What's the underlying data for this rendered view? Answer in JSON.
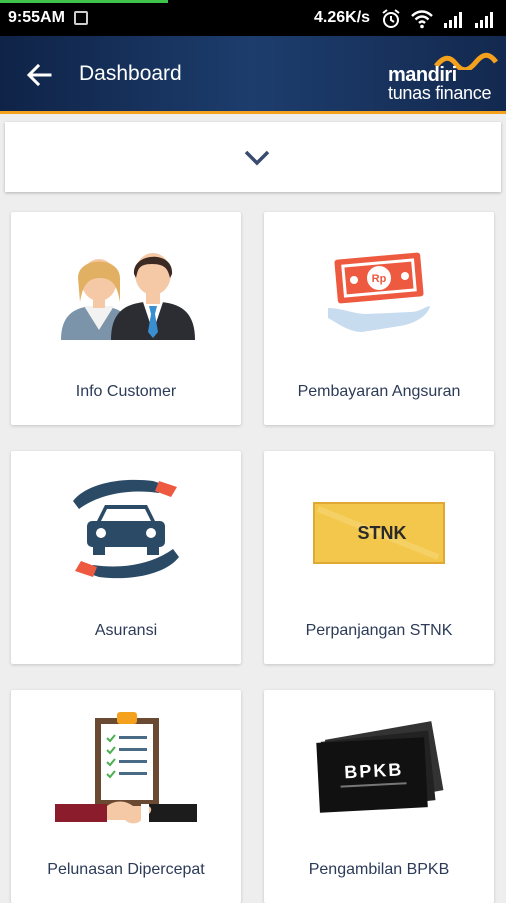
{
  "status_bar": {
    "time": "9:55AM",
    "network_speed": "4.26K/s"
  },
  "header": {
    "title": "Dashboard",
    "brand_line1": "mandiri",
    "brand_line2": "tunas finance"
  },
  "menu": [
    {
      "label": "Info Customer",
      "icon": "customers-icon"
    },
    {
      "label": "Pembayaran Angsuran",
      "icon": "payment-money-icon"
    },
    {
      "label": "Asuransi",
      "icon": "car-insurance-icon"
    },
    {
      "label": "Perpanjangan STNK",
      "icon": "stnk-card-icon",
      "icon_text": "STNK"
    },
    {
      "label": "Pelunasan Dipercepat",
      "icon": "clipboard-handshake-icon"
    },
    {
      "label": "Pengambilan BPKB",
      "icon": "bpkb-book-icon",
      "icon_text": "BPKB"
    }
  ],
  "colors": {
    "appbar": "#13294f",
    "accent": "#f4a21e",
    "text": "#2c3b58"
  }
}
